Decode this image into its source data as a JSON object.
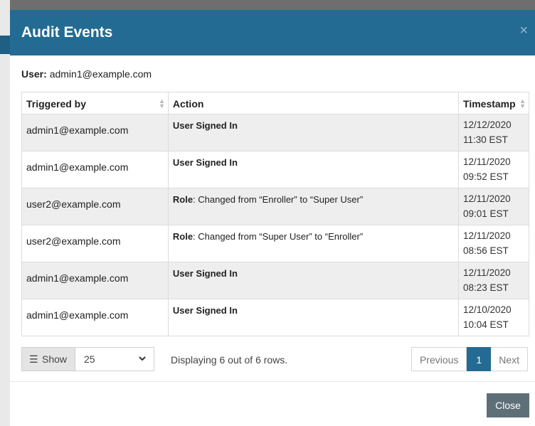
{
  "dialog": {
    "title": "Audit Events",
    "close_symbol": "×"
  },
  "user": {
    "label": "User:",
    "value": "admin1@example.com"
  },
  "table": {
    "headers": [
      "Triggered by",
      "Action",
      "Timestamp"
    ],
    "rows": [
      {
        "triggered_by": "admin1@example.com",
        "action_bold": "User Signed In",
        "action_rest": "",
        "date": "12/12/2020",
        "time": "11:30 EST"
      },
      {
        "triggered_by": "admin1@example.com",
        "action_bold": "User Signed In",
        "action_rest": "",
        "date": "12/11/2020",
        "time": "09:52 EST"
      },
      {
        "triggered_by": "user2@example.com",
        "action_bold": "Role",
        "action_rest": ": Changed from “Enroller” to “Super User”",
        "date": "12/11/2020",
        "time": "09:01 EST"
      },
      {
        "triggered_by": "user2@example.com",
        "action_bold": "Role",
        "action_rest": ": Changed from “Super User” to “Enroller”",
        "date": "12/11/2020",
        "time": "08:56 EST"
      },
      {
        "triggered_by": "admin1@example.com",
        "action_bold": "User Signed In",
        "action_rest": "",
        "date": "12/11/2020",
        "time": "08:23 EST"
      },
      {
        "triggered_by": "admin1@example.com",
        "action_bold": "User Signed In",
        "action_rest": "",
        "date": "12/10/2020",
        "time": "10:04 EST"
      }
    ]
  },
  "footer": {
    "show_label": "Show",
    "page_size": "25",
    "display_text": "Displaying 6 out of 6 rows.",
    "pagination": {
      "previous": "Previous",
      "current": "1",
      "next": "Next"
    },
    "close_label": "Close"
  },
  "colors": {
    "header": "#236b92",
    "close_button": "#5f6f78"
  }
}
